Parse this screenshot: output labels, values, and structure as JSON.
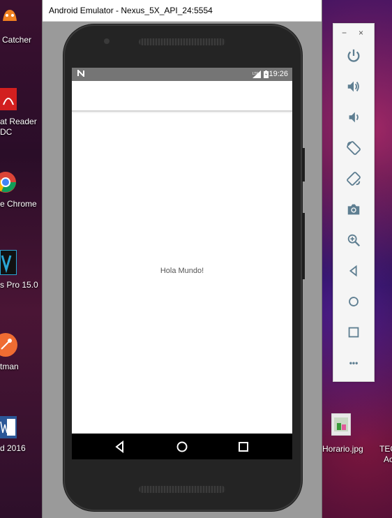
{
  "window": {
    "title": "Android Emulator - Nexus_5X_API_24:5554"
  },
  "status_bar": {
    "time": "19:26"
  },
  "app": {
    "message": "Hola Mundo!"
  },
  "desktop": {
    "left_labels": [
      "Catcher",
      "at Reader",
      "DC",
      "e Chrome",
      "s Pro 15.0",
      "tman",
      "d 2016"
    ],
    "right_labels": [
      "Horario.jpg",
      "TEC",
      "Ac"
    ]
  },
  "toolbar": {
    "minimize": "−",
    "close": "×",
    "more": "•••"
  },
  "colors": {
    "status_bar": "#757575",
    "frame": "#242424",
    "toolbar_icons": "#5e7e91"
  }
}
